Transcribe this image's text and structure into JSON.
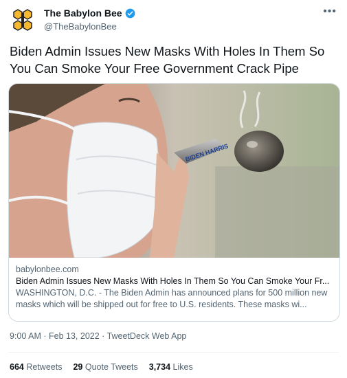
{
  "account": {
    "name": "The Babylon Bee",
    "handle": "@TheBabylonBee",
    "brand_color": "#1d9bf0"
  },
  "tweet": {
    "text": "Biden Admin Issues New Masks With Holes In Them So You Can Smoke Your Free Government Crack Pipe"
  },
  "card": {
    "image_text": "BIDEN HARRIS",
    "domain": "babylonbee.com",
    "title": "Biden Admin Issues New Masks With Holes In Them So You Can Smoke Your Fr...",
    "description": "WASHINGTON, D.C. - The Biden Admin has announced plans for 500 million new masks which will be shipped out for free to U.S. residents. These masks wi..."
  },
  "meta": {
    "time": "9:00 AM",
    "date": "Feb 13, 2022",
    "source": "TweetDeck Web App"
  },
  "stats": {
    "retweets_count": "664",
    "retweets_label": "Retweets",
    "quotes_count": "29",
    "quotes_label": "Quote Tweets",
    "likes_count": "3,734",
    "likes_label": "Likes"
  }
}
